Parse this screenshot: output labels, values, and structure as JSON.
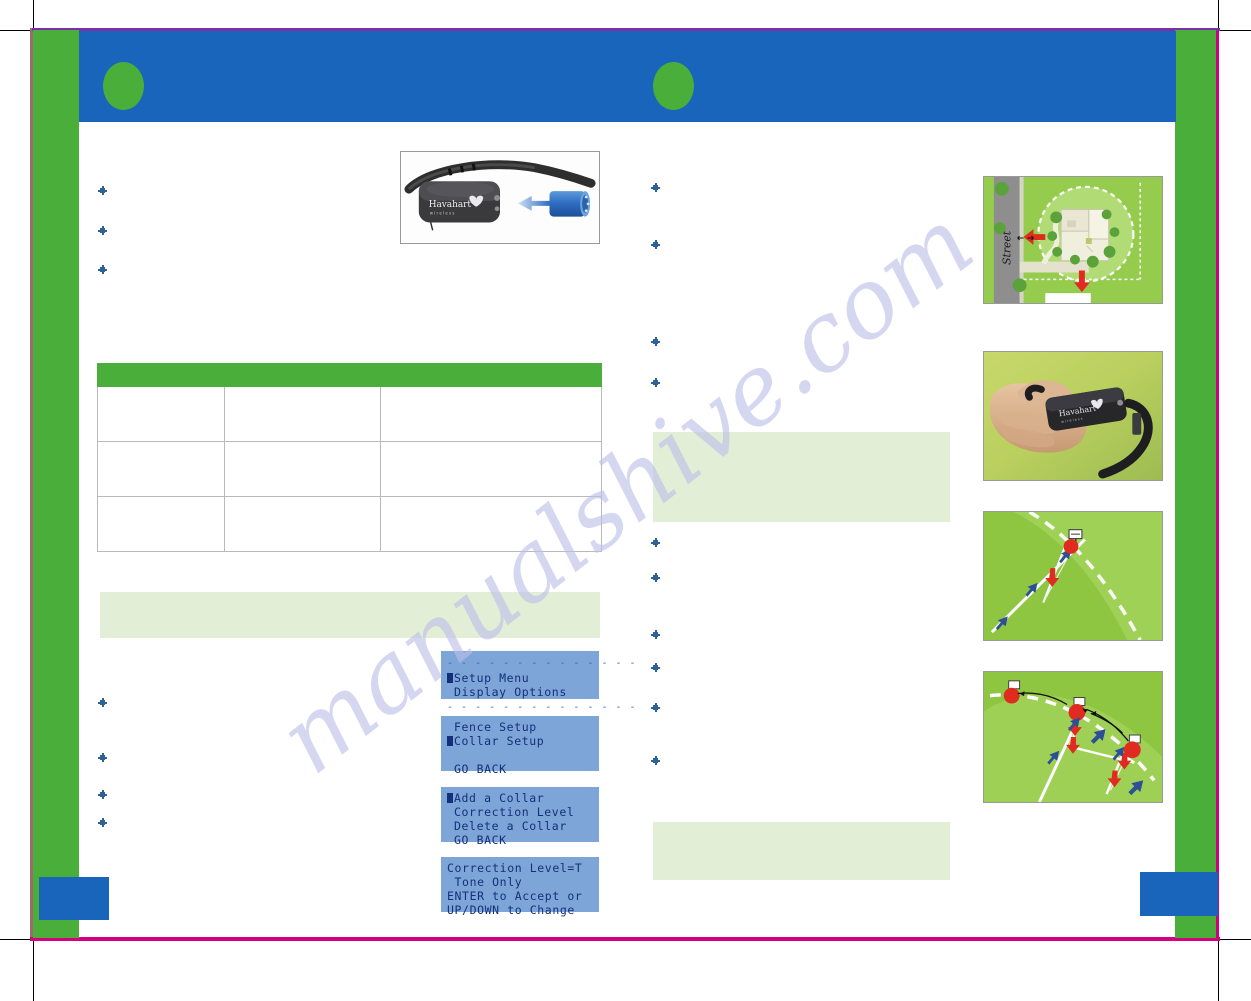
{
  "document": {
    "kind": "printed-manual-page-scan",
    "watermark": "manualshive.com",
    "brand_logo_text": "Havahart",
    "brand_logo_sub": "wireless"
  },
  "colors": {
    "header_blue": "#1965bb",
    "brand_green": "#4aae3b",
    "info_box_green": "#e3eed6",
    "lcd_blue": "#7da5d8",
    "lcd_text": "#15307a",
    "rule_magenta": "#d2007f",
    "rule_purple": "#7b2fa8",
    "bullet_blue": "#2e6196",
    "flag_red": "#e02b20",
    "arrow_blue": "#2d4f96"
  },
  "header": {
    "title": "",
    "section_badge_left": "",
    "section_badge_right": ""
  },
  "footer": {
    "page_number_left": "",
    "page_number_right": ""
  },
  "left_column": {
    "bullets": [
      "",
      "",
      "",
      "",
      "",
      "",
      ""
    ],
    "info_box_text": "",
    "table": {
      "headers": [
        "",
        "",
        ""
      ],
      "rows": [
        [
          "",
          "",
          ""
        ],
        [
          "",
          "",
          ""
        ],
        [
          "",
          "",
          ""
        ]
      ]
    }
  },
  "middle_column": {
    "bullets": [
      "",
      "",
      "",
      "",
      "",
      "",
      "",
      "",
      "",
      ""
    ],
    "info_box_1_text": "",
    "info_box_2_text": ""
  },
  "lcd_screens": [
    {
      "name": "setup-menu",
      "top_rule": "- - - - - - - - - - - - - -",
      "lines": [
        "Setup Menu",
        "Display Options"
      ],
      "selected_index": 0,
      "bottom_rule": "- - - - - - - - - - - - - -"
    },
    {
      "name": "fence-collar-setup",
      "lines": [
        "Fence Setup",
        "Collar Setup",
        "",
        "GO BACK"
      ],
      "selected_index": 1
    },
    {
      "name": "collar-setup-menu",
      "lines": [
        "Add a Collar",
        "Correction Level",
        "Delete a Collar",
        "GO BACK"
      ],
      "selected_index": 0
    },
    {
      "name": "correction-level",
      "lines": [
        "Correction Level=T",
        " Tone Only",
        "ENTER to Accept or",
        "UP/DOWN to Change"
      ],
      "selected_index": -1
    }
  ],
  "figures": [
    {
      "name": "collar-battery-insert",
      "caption": "",
      "description": "Black receiver collar with Havahart logo and a blue cylindrical battery with arrow pointing into the collar"
    },
    {
      "name": "yard-boundary-map",
      "caption": "",
      "label_street": "Street",
      "description": "Aerial yard plan: house, circular wireless boundary, dashed property line, red arrows"
    },
    {
      "name": "hand-holding-collar",
      "caption": "",
      "description": "Photo of a hand holding the black receiver collar over grass"
    },
    {
      "name": "training-flags-single",
      "caption": "",
      "description": "Green yard with dashed boundary, one boundary flag, red and blue directional arrows"
    },
    {
      "name": "training-flags-multi",
      "caption": "",
      "description": "Green yard with dashed boundary, three boundary flags, red and blue directional arrows along the boundary"
    }
  ]
}
